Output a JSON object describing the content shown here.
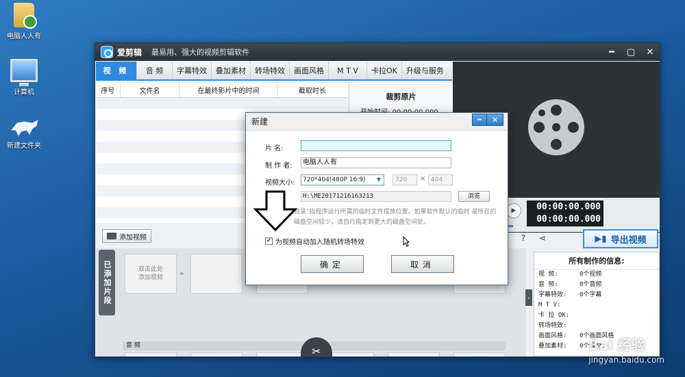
{
  "desktop": {
    "icons": [
      {
        "label": "电脑人人有",
        "icon": "folder-user-icon"
      },
      {
        "label": "计算机",
        "icon": "computer-icon"
      },
      {
        "label": "新建文件夹",
        "icon": "tiger-folder-icon"
      }
    ]
  },
  "window": {
    "app_name": "爱剪辑",
    "slogan": "最易用、强大的视频剪辑软件",
    "controls": {
      "minimize": "━",
      "maximize": "▢",
      "close": "✕"
    },
    "tabs": [
      "视 频",
      "音 频",
      "字幕特效",
      "叠加素材",
      "转场特效",
      "画面风格",
      "M T V",
      "卡拉OK",
      "升级与服务"
    ],
    "active_tab": "视 频"
  },
  "file_table": {
    "columns": [
      "序号",
      "文件名",
      "在最终影片中的时间",
      "截取时长"
    ]
  },
  "crop_panel": {
    "title": "裁剪原片",
    "start_label": "开始时间:",
    "start_value": "00:00:00.000"
  },
  "player": {
    "time_current": "00:00:00.000",
    "time_total": "00:00:00.000"
  },
  "add_video_label": "添加视频",
  "added_clips_label": "已添加片段",
  "clip_placeholder": "双击此处\n添加视频",
  "audio_label": "音 频",
  "export_label": "导出视频",
  "info_panel": {
    "title": "所有制作的信息:",
    "rows": [
      {
        "key": "视    频:",
        "value": "0个视频"
      },
      {
        "key": "音    频:",
        "value": "0个音频"
      },
      {
        "key": "字幕特效:",
        "value": "0个字幕"
      },
      {
        "key": "M  T  V:",
        "value": ""
      },
      {
        "key": "卡 拉 OK:",
        "value": ""
      },
      {
        "key": "转场特效:",
        "value": ""
      },
      {
        "key": "画面风格:",
        "value": "0个画面风格"
      },
      {
        "key": "叠加素材:",
        "value": "0个素材"
      }
    ]
  },
  "dialog": {
    "title": "新建",
    "name_label": "片    名:",
    "name_value": "",
    "author_label": "制 作 者:",
    "author_value": "电脑人人有",
    "size_label": "视频大小:",
    "size_value": "720*404(480P 16:9)",
    "width_value": "720",
    "times": "×",
    "height_value": "404",
    "path_value": "H:\\ME20171216163213",
    "browse_label": "浏览",
    "hint": "目录”指程序运行所需的临时文件摆放位置。如果软件默认的临时 录所在的磁盘空间较少，请自行指定到更大的磁盘空间处。",
    "checkbox_label": "为视频自动加入随机转场特效",
    "checkbox_checked": true,
    "ok_label": "确定",
    "cancel_label": "取消"
  },
  "watermark": {
    "main": "Bai 经验",
    "sub": "jingyan.baidu.com"
  }
}
